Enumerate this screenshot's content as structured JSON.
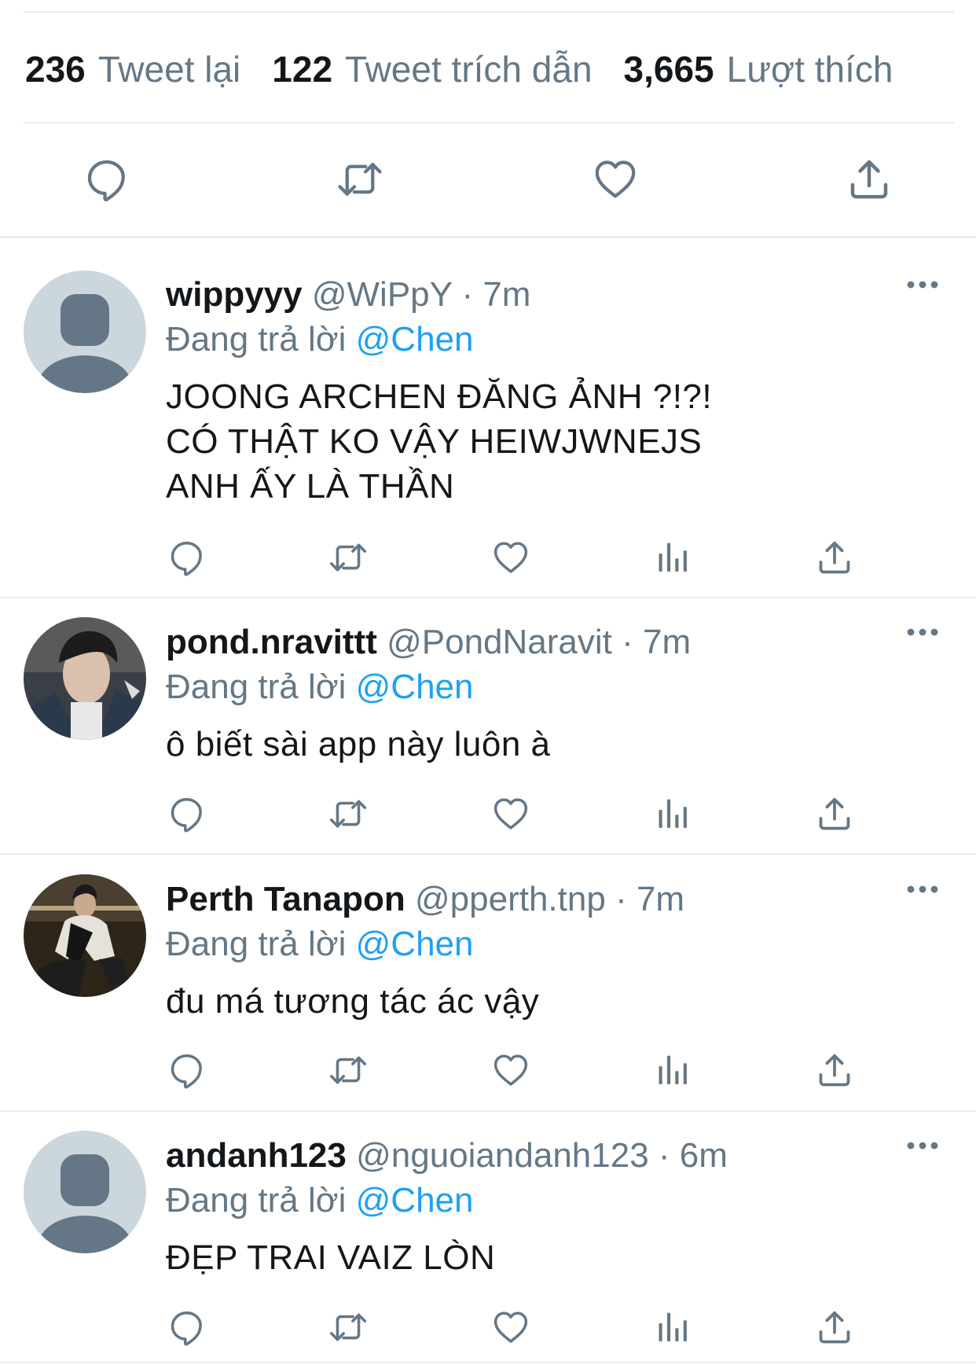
{
  "stats": [
    {
      "count": "236",
      "label": "Tweet lại"
    },
    {
      "count": "122",
      "label": "Tweet trích dẫn"
    },
    {
      "count": "3,665",
      "label": "Lượt thích"
    }
  ],
  "icons": {
    "reply": "reply-icon",
    "retweet": "retweet-icon",
    "like": "heart-icon",
    "share": "share-icon",
    "analytics": "analytics-icon",
    "more": "more-icon"
  },
  "colors": {
    "link": "#1da1f2",
    "secondary_text": "#657786",
    "icon": "#657786",
    "divider": "#e6ecf0"
  },
  "replies": [
    {
      "name": "wippyyy",
      "handle": "@WiPpY",
      "separator": "·",
      "time": "7m",
      "replying_prefix": "Đang trả lời",
      "replying_to": "@Chen",
      "text": "JOONG ARCHEN ĐĂNG ẢNH ?!?!\nCÓ THẬT KO VẬY HEIWJWNEJS\nANH ẤY LÀ THẦN",
      "avatar": "default-avatar"
    },
    {
      "name": "pond.nravittt",
      "handle": "@PondNaravit",
      "separator": "·",
      "time": "7m",
      "replying_prefix": "Đang trả lời",
      "replying_to": "@Chen",
      "text": "ô biết sài app này luôn à",
      "avatar": "photo-avatar"
    },
    {
      "name": "Perth Tanapon",
      "handle": "@pperth.tnp",
      "separator": "·",
      "time": "7m",
      "replying_prefix": "Đang trả lời",
      "replying_to": "@Chen",
      "text": "đu má tương tác ác vậy",
      "avatar": "photo-avatar"
    },
    {
      "name": "andanh123",
      "handle": "@nguoiandanh123",
      "separator": "·",
      "time": "6m",
      "replying_prefix": "Đang trả lời",
      "replying_to": "@Chen",
      "text": "ĐẸP TRAI VAIZ LÒN",
      "avatar": "default-avatar"
    }
  ]
}
